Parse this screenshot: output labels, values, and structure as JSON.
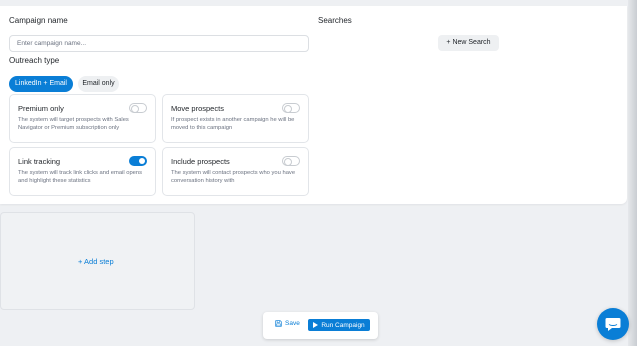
{
  "campaign": {
    "name_label": "Campaign name",
    "name_placeholder": "Enter campaign name...",
    "name_value": ""
  },
  "outreach": {
    "label": "Outreach type",
    "options": [
      {
        "label": "LinkedIn + Email",
        "selected": true
      },
      {
        "label": "Email only",
        "selected": false
      }
    ]
  },
  "options": [
    {
      "title": "Premium only",
      "description": "The system will target prospects with Sales Navigator or Premium subscription only",
      "enabled": false
    },
    {
      "title": "Move prospects",
      "description": "If prospect exists in another campaign he will be moved to this campaign",
      "enabled": false
    },
    {
      "title": "Link tracking",
      "description": "The system will track link clicks and email opens and highlight these statistics",
      "enabled": true
    },
    {
      "title": "Include prospects",
      "description": "The system will contact prospects who you have conversation history with",
      "enabled": false
    }
  ],
  "searches": {
    "label": "Searches",
    "new_search_label": "+ New Search"
  },
  "steps": {
    "add_step_label": "+  Add step"
  },
  "actions": {
    "save_label": "Save",
    "run_label": "Run Campaign"
  },
  "colors": {
    "accent": "#0a7ed6",
    "background": "#eef0f3"
  },
  "icons": [
    "save-icon",
    "play-icon",
    "chat-icon"
  ]
}
